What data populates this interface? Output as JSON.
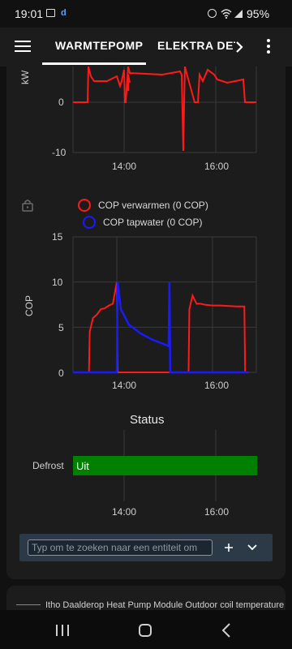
{
  "status_bar": {
    "time": "19:01",
    "battery": "95%",
    "notif_d": "d"
  },
  "toolbar": {
    "tabs": [
      {
        "label": "WARMTEPOMP"
      },
      {
        "label": "ELEKTRA DETA"
      }
    ]
  },
  "charts": [
    {
      "id": "power",
      "y_unit_label": "kW",
      "y_ticks": [
        "0",
        "-10"
      ],
      "x_ticks": [
        "14:00",
        "16:00"
      ]
    },
    {
      "id": "cop",
      "legend": [
        "COP verwarmen (0 COP)",
        "COP tapwater (0 COP)"
      ],
      "ylabel": "COP",
      "y_ticks": [
        "15",
        "10",
        "5",
        "0"
      ],
      "x_ticks": [
        "14:00",
        "16:00"
      ]
    },
    {
      "id": "status",
      "title": "Status",
      "row_label": "Defrost",
      "bar_value": "Uit",
      "x_ticks": [
        "14:00",
        "16:00"
      ]
    }
  ],
  "chart_data": [
    {
      "type": "line",
      "xlabel": "",
      "ylabel": "kW",
      "ylim": [
        -10,
        7
      ],
      "x_ticks": [
        "14:00",
        "16:00"
      ],
      "series": [
        {
          "color": "#ff1a1a",
          "x": [
            "13:05",
            "13:25",
            "13:27",
            "13:40",
            "13:48",
            "13:56",
            "14:00",
            "14:04",
            "14:40",
            "15:07",
            "15:10",
            "15:12",
            "15:14",
            "15:24",
            "15:40",
            "15:50",
            "16:05",
            "16:40",
            "16:47",
            "16:48",
            "16:55"
          ],
          "y": [
            0,
            0,
            6.5,
            6.5,
            3.8,
            5.5,
            0,
            6,
            5.8,
            6,
            -9.4,
            6.5,
            0,
            0,
            4.8,
            6,
            4,
            3.7,
            3.5,
            0,
            0
          ]
        }
      ]
    },
    {
      "type": "line",
      "xlabel": "",
      "ylabel": "COP",
      "ylim": [
        0,
        15
      ],
      "y_ticks": [
        0,
        5,
        10,
        15
      ],
      "x_ticks": [
        "14:00",
        "16:00"
      ],
      "series": [
        {
          "name": "COP verwarmen",
          "color": "#ff1a1a",
          "x": [
            "13:05",
            "13:25",
            "13:26",
            "13:30",
            "13:35",
            "13:40",
            "13:45",
            "13:50",
            "13:55",
            "14:00",
            "14:01",
            "15:30",
            "15:31",
            "15:35",
            "15:40",
            "15:45",
            "15:50",
            "16:00",
            "16:10",
            "16:30",
            "16:40",
            "16:41",
            "16:45"
          ],
          "y": [
            0,
            0,
            4.5,
            6,
            6.4,
            7,
            7.1,
            7.4,
            7.6,
            10,
            0,
            0,
            7,
            8.5,
            7.6,
            7.6,
            7.5,
            7.4,
            7.4,
            7.3,
            7.3,
            0,
            0
          ]
        },
        {
          "name": "COP tapwater",
          "color": "#1a1aff",
          "x": [
            "13:05",
            "14:00",
            "14:01",
            "14:05",
            "14:15",
            "14:30",
            "14:45",
            "15:00",
            "15:05",
            "15:06",
            "15:07",
            "16:45"
          ],
          "y": [
            0,
            0,
            10,
            7,
            5.3,
            4.3,
            3.6,
            3.1,
            2.9,
            10,
            0,
            0
          ]
        }
      ]
    },
    {
      "type": "bar",
      "title": "Status",
      "categories": [
        "Defrost"
      ],
      "values": [
        "Uit"
      ],
      "bar_color": "#008000",
      "x_ticks": [
        "14:00",
        "16:00"
      ]
    }
  ],
  "search": {
    "placeholder": "Typ om te zoeken naar een entiteit om"
  },
  "bottom_card": {
    "legend_label": "Itho Daalderop Heat Pump Module Outdoor coil temperature"
  }
}
